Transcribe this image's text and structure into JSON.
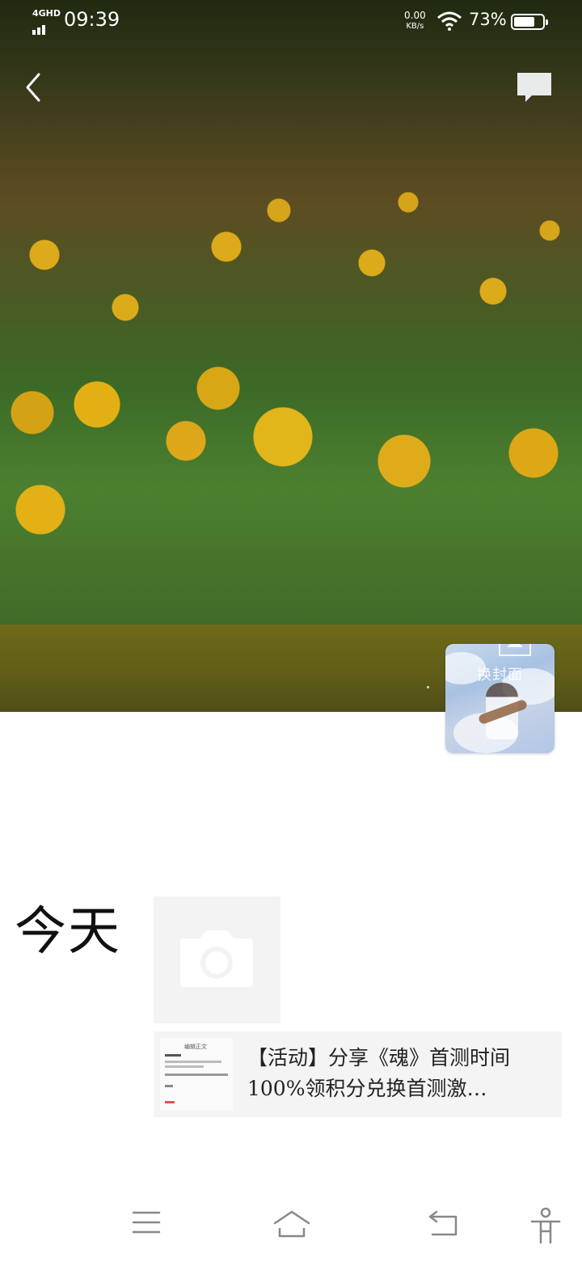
{
  "status_bar": {
    "network": "4GHD",
    "time": "09:39",
    "speed_value": "0.00",
    "speed_unit": "KB/s",
    "battery_percent": "73%",
    "battery_level": 0.73
  },
  "header": {
    "back_icon": "chevron-left-icon",
    "chat_icon": "chat-bubble-icon"
  },
  "cover": {
    "change_cover_label": "换封面",
    "upload_icon": "upload-icon"
  },
  "content": {
    "day_label": "今天",
    "photo_icon": "camera-icon",
    "share_card": {
      "text": "【活动】分享《魂》首测时间 100%领积分兑换首测激…",
      "thumb_title": "编辑正文"
    }
  },
  "nav_bar": {
    "menu_icon": "menu-icon",
    "home_icon": "home-icon",
    "back_icon": "return-icon",
    "accessibility_icon": "accessibility-icon"
  }
}
